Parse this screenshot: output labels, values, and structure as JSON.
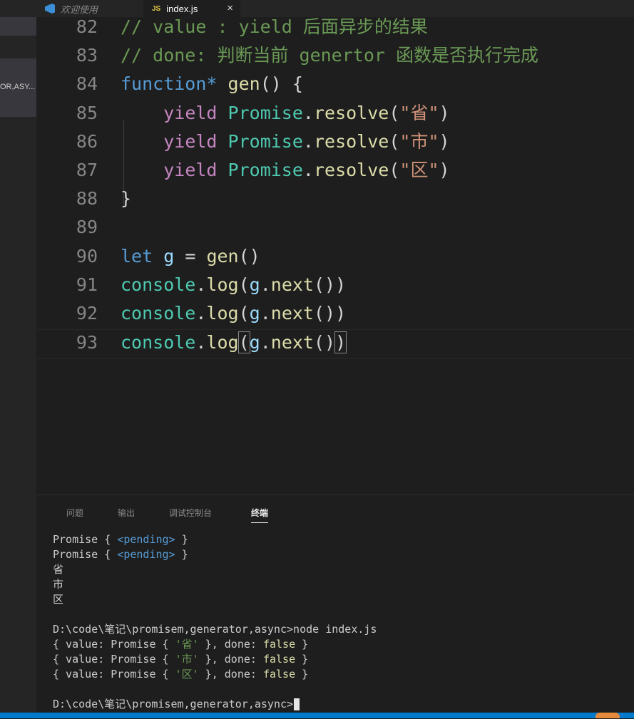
{
  "tabs": {
    "welcome": "欢迎使用",
    "index_js": {
      "icon_text": "JS",
      "label": "index.js",
      "close": "×"
    }
  },
  "sidebar": {
    "item_label": "OR,ASY..."
  },
  "editor": {
    "lines": [
      {
        "num": "82",
        "tokens": [
          [
            "// value : yield 后面异步的结果",
            "cmt"
          ]
        ]
      },
      {
        "num": "83",
        "tokens": [
          [
            "// done: 判断当前 genertor 函数是否执行完成",
            "cmt"
          ]
        ]
      },
      {
        "num": "84",
        "tokens": [
          [
            "function",
            "kw"
          ],
          [
            "* ",
            "kw"
          ],
          [
            "gen",
            "fn"
          ],
          [
            "() {",
            "pl"
          ]
        ]
      },
      {
        "num": "85",
        "tokens": [
          [
            "    ",
            "pl"
          ],
          [
            "yield",
            "ctl"
          ],
          [
            " ",
            "pl"
          ],
          [
            "Promise",
            "cls"
          ],
          [
            ".",
            "pl"
          ],
          [
            "resolve",
            "fn"
          ],
          [
            "(",
            "pl"
          ],
          [
            "\"省\"",
            "str"
          ],
          [
            ")",
            "pl"
          ]
        ]
      },
      {
        "num": "86",
        "tokens": [
          [
            "    ",
            "pl"
          ],
          [
            "yield",
            "ctl"
          ],
          [
            " ",
            "pl"
          ],
          [
            "Promise",
            "cls"
          ],
          [
            ".",
            "pl"
          ],
          [
            "resolve",
            "fn"
          ],
          [
            "(",
            "pl"
          ],
          [
            "\"市\"",
            "str"
          ],
          [
            ")",
            "pl"
          ]
        ]
      },
      {
        "num": "87",
        "tokens": [
          [
            "    ",
            "pl"
          ],
          [
            "yield",
            "ctl"
          ],
          [
            " ",
            "pl"
          ],
          [
            "Promise",
            "cls"
          ],
          [
            ".",
            "pl"
          ],
          [
            "resolve",
            "fn"
          ],
          [
            "(",
            "pl"
          ],
          [
            "\"区\"",
            "str"
          ],
          [
            ")",
            "pl"
          ]
        ]
      },
      {
        "num": "88",
        "tokens": [
          [
            "}",
            "pl"
          ]
        ]
      },
      {
        "num": "89",
        "tokens": []
      },
      {
        "num": "90",
        "tokens": [
          [
            "let",
            "kw"
          ],
          [
            " ",
            "pl"
          ],
          [
            "g",
            "var"
          ],
          [
            " = ",
            "pl"
          ],
          [
            "gen",
            "fn"
          ],
          [
            "()",
            "pl"
          ]
        ]
      },
      {
        "num": "91",
        "tokens": [
          [
            "console",
            "cls"
          ],
          [
            ".",
            "pl"
          ],
          [
            "log",
            "fn"
          ],
          [
            "(",
            "pl"
          ],
          [
            "g",
            "var"
          ],
          [
            ".",
            "pl"
          ],
          [
            "next",
            "fn"
          ],
          [
            "())",
            "pl"
          ]
        ]
      },
      {
        "num": "92",
        "tokens": [
          [
            "console",
            "cls"
          ],
          [
            ".",
            "pl"
          ],
          [
            "log",
            "fn"
          ],
          [
            "(",
            "pl"
          ],
          [
            "g",
            "var"
          ],
          [
            ".",
            "pl"
          ],
          [
            "next",
            "fn"
          ],
          [
            "())",
            "pl"
          ]
        ]
      },
      {
        "num": "93",
        "tokens": [
          [
            "console",
            "cls"
          ],
          [
            ".",
            "pl"
          ],
          [
            "log",
            "fn"
          ],
          [
            "(",
            "bm"
          ],
          [
            "g",
            "var"
          ],
          [
            ".",
            "pl"
          ],
          [
            "next",
            "fn"
          ],
          [
            "()",
            "pl"
          ],
          [
            ")",
            "bm"
          ]
        ]
      }
    ]
  },
  "panel": {
    "tabs": [
      "问题",
      "输出",
      "调试控制台",
      "终端"
    ],
    "active_tab": "终端"
  },
  "terminal": {
    "lines": [
      [
        [
          "Promise { ",
          "pl"
        ],
        [
          "<pending>",
          "blue"
        ],
        [
          " }",
          "pl"
        ]
      ],
      [
        [
          "Promise { ",
          "pl"
        ],
        [
          "<pending>",
          "blue"
        ],
        [
          " }",
          "pl"
        ]
      ],
      [
        [
          "省",
          "pl"
        ]
      ],
      [
        [
          "市",
          "pl"
        ]
      ],
      [
        [
          "区",
          "pl"
        ]
      ],
      [
        [
          "",
          "pl"
        ]
      ],
      [
        [
          "D:\\code\\笔记\\promisem,generator,async>node index.js",
          "pl"
        ]
      ],
      [
        [
          "{ value: Promise { ",
          "pl"
        ],
        [
          "'省'",
          "green"
        ],
        [
          " }, done: ",
          "pl"
        ],
        [
          "false",
          "yel"
        ],
        [
          " }",
          "pl"
        ]
      ],
      [
        [
          "{ value: Promise { ",
          "pl"
        ],
        [
          "'市'",
          "green"
        ],
        [
          " }, done: ",
          "pl"
        ],
        [
          "false",
          "yel"
        ],
        [
          " }",
          "pl"
        ]
      ],
      [
        [
          "{ value: Promise { ",
          "pl"
        ],
        [
          "'区'",
          "green"
        ],
        [
          " }, done: ",
          "pl"
        ],
        [
          "false",
          "yel"
        ],
        [
          " }",
          "pl"
        ]
      ],
      [
        [
          "",
          "pl"
        ]
      ],
      [
        [
          "D:\\code\\笔记\\promisem,generator,async>",
          "pl"
        ]
      ]
    ]
  },
  "colors": {
    "editor_bg": "#1e1e1e",
    "sidebar_bg": "#252526",
    "statusbar": "#007acc",
    "comment": "#6a9955",
    "keyword": "#569cd6",
    "function": "#dcdcaa",
    "class": "#4ec9b0",
    "string": "#ce9178"
  }
}
